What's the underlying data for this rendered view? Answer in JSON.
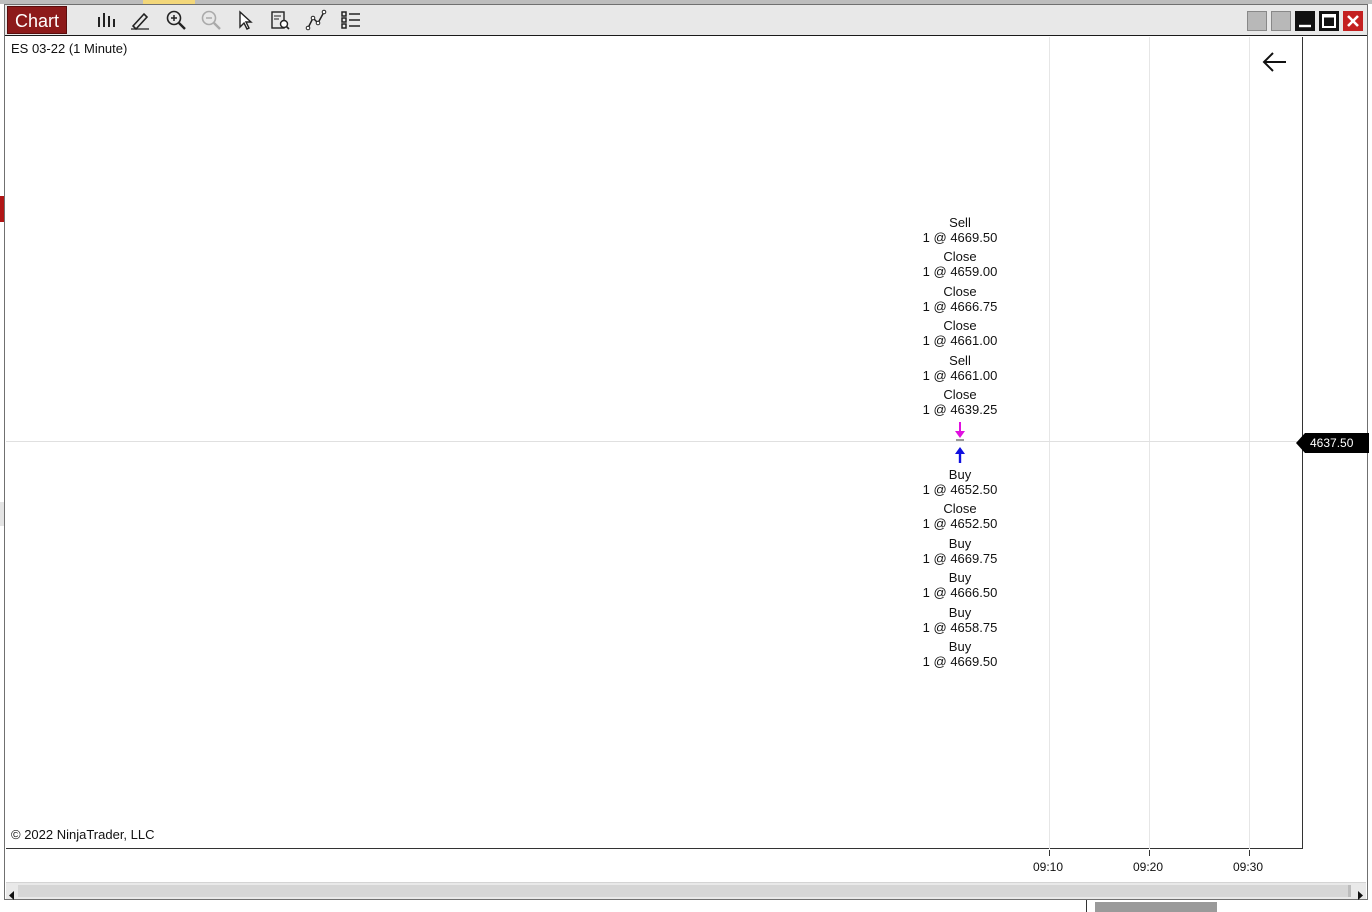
{
  "window": {
    "tab_label": "Chart",
    "toolbar": [
      {
        "name": "bar-chart-icon"
      },
      {
        "name": "pencil-icon"
      },
      {
        "name": "zoom-in-icon"
      },
      {
        "name": "zoom-out-icon"
      },
      {
        "name": "pointer-icon"
      },
      {
        "name": "data-box-icon"
      },
      {
        "name": "strategy-icon"
      },
      {
        "name": "properties-list-icon"
      }
    ]
  },
  "chart": {
    "instrument": "ES 03-22 (1 Minute)",
    "copyright": "© 2022 NinjaTrader, LLC",
    "current_price": "4637.50",
    "x_ticks": [
      "09:10",
      "09:20",
      "09:30"
    ],
    "sell_side": [
      {
        "action": "Sell",
        "fill": "1 @ 4669.50"
      },
      {
        "action": "Close",
        "fill": "1 @ 4659.00"
      },
      {
        "action": "Close",
        "fill": "1 @ 4666.75"
      },
      {
        "action": "Close",
        "fill": "1 @ 4661.00"
      },
      {
        "action": "Sell",
        "fill": "1 @ 4661.00"
      },
      {
        "action": "Close",
        "fill": "1 @ 4639.25"
      }
    ],
    "buy_side": [
      {
        "action": "Buy",
        "fill": "1 @ 4652.50"
      },
      {
        "action": "Close",
        "fill": "1 @ 4652.50"
      },
      {
        "action": "Buy",
        "fill": "1 @ 4669.75"
      },
      {
        "action": "Buy",
        "fill": "1 @ 4666.50"
      },
      {
        "action": "Buy",
        "fill": "1 @ 4658.75"
      },
      {
        "action": "Buy",
        "fill": "1 @ 4669.50"
      }
    ],
    "colors": {
      "sell_marker": "#e010e0",
      "buy_marker": "#1010e0",
      "price_tag": "#000000",
      "tab": "#8d1a1a"
    }
  }
}
